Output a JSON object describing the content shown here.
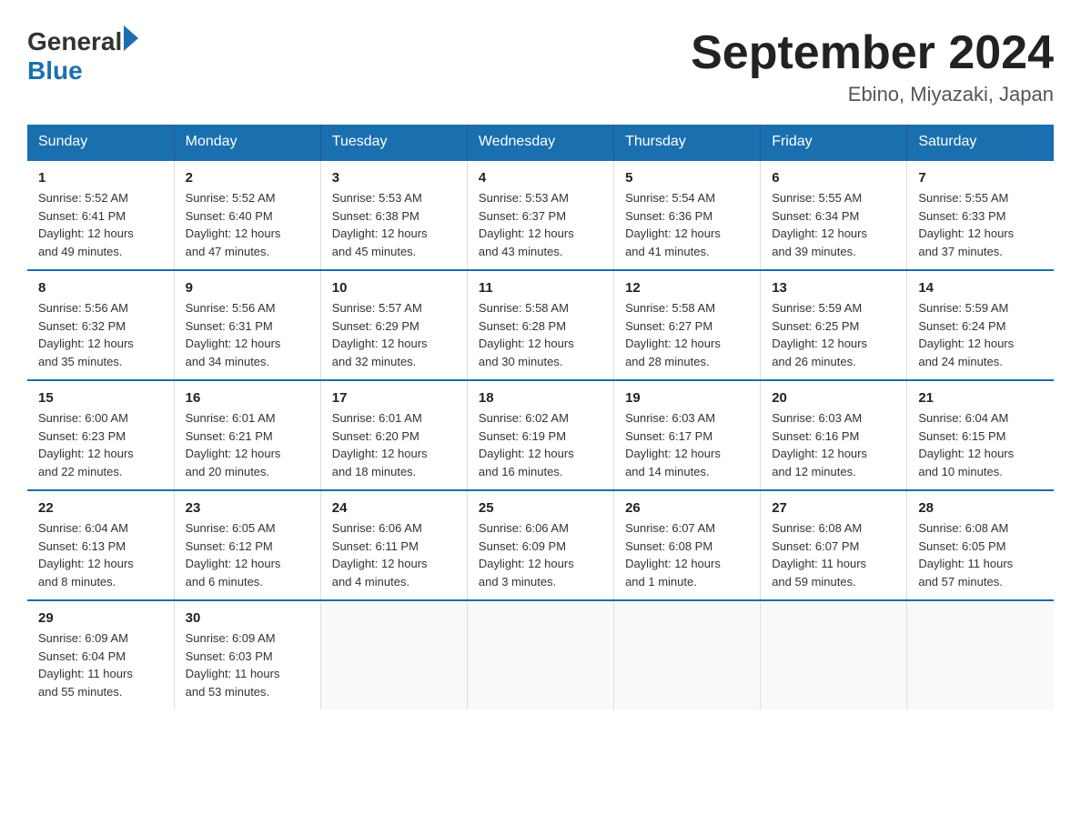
{
  "logo": {
    "text_general": "General",
    "text_blue": "Blue"
  },
  "header": {
    "title": "September 2024",
    "subtitle": "Ebino, Miyazaki, Japan"
  },
  "days_of_week": [
    "Sunday",
    "Monday",
    "Tuesday",
    "Wednesday",
    "Thursday",
    "Friday",
    "Saturday"
  ],
  "weeks": [
    [
      {
        "day": "1",
        "sunrise": "5:52 AM",
        "sunset": "6:41 PM",
        "daylight": "12 hours and 49 minutes."
      },
      {
        "day": "2",
        "sunrise": "5:52 AM",
        "sunset": "6:40 PM",
        "daylight": "12 hours and 47 minutes."
      },
      {
        "day": "3",
        "sunrise": "5:53 AM",
        "sunset": "6:38 PM",
        "daylight": "12 hours and 45 minutes."
      },
      {
        "day": "4",
        "sunrise": "5:53 AM",
        "sunset": "6:37 PM",
        "daylight": "12 hours and 43 minutes."
      },
      {
        "day": "5",
        "sunrise": "5:54 AM",
        "sunset": "6:36 PM",
        "daylight": "12 hours and 41 minutes."
      },
      {
        "day": "6",
        "sunrise": "5:55 AM",
        "sunset": "6:34 PM",
        "daylight": "12 hours and 39 minutes."
      },
      {
        "day": "7",
        "sunrise": "5:55 AM",
        "sunset": "6:33 PM",
        "daylight": "12 hours and 37 minutes."
      }
    ],
    [
      {
        "day": "8",
        "sunrise": "5:56 AM",
        "sunset": "6:32 PM",
        "daylight": "12 hours and 35 minutes."
      },
      {
        "day": "9",
        "sunrise": "5:56 AM",
        "sunset": "6:31 PM",
        "daylight": "12 hours and 34 minutes."
      },
      {
        "day": "10",
        "sunrise": "5:57 AM",
        "sunset": "6:29 PM",
        "daylight": "12 hours and 32 minutes."
      },
      {
        "day": "11",
        "sunrise": "5:58 AM",
        "sunset": "6:28 PM",
        "daylight": "12 hours and 30 minutes."
      },
      {
        "day": "12",
        "sunrise": "5:58 AM",
        "sunset": "6:27 PM",
        "daylight": "12 hours and 28 minutes."
      },
      {
        "day": "13",
        "sunrise": "5:59 AM",
        "sunset": "6:25 PM",
        "daylight": "12 hours and 26 minutes."
      },
      {
        "day": "14",
        "sunrise": "5:59 AM",
        "sunset": "6:24 PM",
        "daylight": "12 hours and 24 minutes."
      }
    ],
    [
      {
        "day": "15",
        "sunrise": "6:00 AM",
        "sunset": "6:23 PM",
        "daylight": "12 hours and 22 minutes."
      },
      {
        "day": "16",
        "sunrise": "6:01 AM",
        "sunset": "6:21 PM",
        "daylight": "12 hours and 20 minutes."
      },
      {
        "day": "17",
        "sunrise": "6:01 AM",
        "sunset": "6:20 PM",
        "daylight": "12 hours and 18 minutes."
      },
      {
        "day": "18",
        "sunrise": "6:02 AM",
        "sunset": "6:19 PM",
        "daylight": "12 hours and 16 minutes."
      },
      {
        "day": "19",
        "sunrise": "6:03 AM",
        "sunset": "6:17 PM",
        "daylight": "12 hours and 14 minutes."
      },
      {
        "day": "20",
        "sunrise": "6:03 AM",
        "sunset": "6:16 PM",
        "daylight": "12 hours and 12 minutes."
      },
      {
        "day": "21",
        "sunrise": "6:04 AM",
        "sunset": "6:15 PM",
        "daylight": "12 hours and 10 minutes."
      }
    ],
    [
      {
        "day": "22",
        "sunrise": "6:04 AM",
        "sunset": "6:13 PM",
        "daylight": "12 hours and 8 minutes."
      },
      {
        "day": "23",
        "sunrise": "6:05 AM",
        "sunset": "6:12 PM",
        "daylight": "12 hours and 6 minutes."
      },
      {
        "day": "24",
        "sunrise": "6:06 AM",
        "sunset": "6:11 PM",
        "daylight": "12 hours and 4 minutes."
      },
      {
        "day": "25",
        "sunrise": "6:06 AM",
        "sunset": "6:09 PM",
        "daylight": "12 hours and 3 minutes."
      },
      {
        "day": "26",
        "sunrise": "6:07 AM",
        "sunset": "6:08 PM",
        "daylight": "12 hours and 1 minute."
      },
      {
        "day": "27",
        "sunrise": "6:08 AM",
        "sunset": "6:07 PM",
        "daylight": "11 hours and 59 minutes."
      },
      {
        "day": "28",
        "sunrise": "6:08 AM",
        "sunset": "6:05 PM",
        "daylight": "11 hours and 57 minutes."
      }
    ],
    [
      {
        "day": "29",
        "sunrise": "6:09 AM",
        "sunset": "6:04 PM",
        "daylight": "11 hours and 55 minutes."
      },
      {
        "day": "30",
        "sunrise": "6:09 AM",
        "sunset": "6:03 PM",
        "daylight": "11 hours and 53 minutes."
      },
      null,
      null,
      null,
      null,
      null
    ]
  ]
}
